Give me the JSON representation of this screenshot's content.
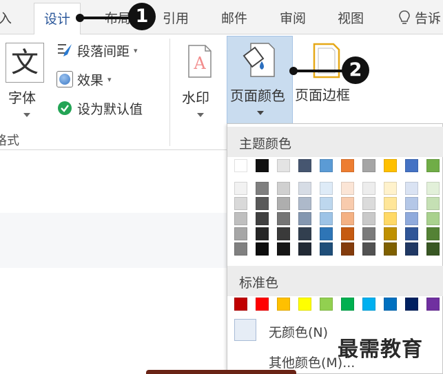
{
  "tabs": [
    {
      "name": "tab-insert",
      "label": "入"
    },
    {
      "name": "tab-design",
      "label": "设计",
      "active": true
    },
    {
      "name": "tab-layout",
      "label": "布局"
    },
    {
      "name": "tab-references",
      "label": "引用"
    },
    {
      "name": "tab-mailings",
      "label": "邮件"
    },
    {
      "name": "tab-review",
      "label": "审阅"
    },
    {
      "name": "tab-view",
      "label": "视图"
    },
    {
      "name": "tab-tell-me",
      "label": "告诉",
      "icon": "lightbulb-icon"
    }
  ],
  "ribbon": {
    "fonts_label": "字体",
    "paragraph_spacing_label": "段落间距",
    "effects_label": "效果",
    "set_default_label": "设为默认值",
    "group_label": "格式",
    "watermark_label": "水印",
    "page_color_label": "页面颜色",
    "page_borders_label": "页面边框"
  },
  "color_panel": {
    "theme_colors_title": "主题颜色",
    "theme_base": [
      "#ffffff",
      "#111111",
      "#e4e4e4",
      "#465670",
      "#5b9bd5",
      "#ed7d31",
      "#a5a5a5",
      "#ffc000",
      "#4472c4",
      "#70ad47"
    ],
    "theme_shades": [
      [
        "#f2f2f2",
        "#d9d9d9",
        "#bfbfbf",
        "#a6a6a6",
        "#808080"
      ],
      [
        "#7f7f7f",
        "#595959",
        "#404040",
        "#262626",
        "#0d0d0d"
      ],
      [
        "#d0d0d0",
        "#aeaeae",
        "#757575",
        "#3a3a3a",
        "#161616"
      ],
      [
        "#d6dce5",
        "#adb9ca",
        "#8497b0",
        "#323f4f",
        "#222a35"
      ],
      [
        "#deebf7",
        "#bdd7ee",
        "#9dc3e6",
        "#2e75b6",
        "#1f4e79"
      ],
      [
        "#fbe5d6",
        "#f8cbad",
        "#f4b183",
        "#c55a11",
        "#843c0c"
      ],
      [
        "#ededed",
        "#dbdbdb",
        "#c9c9c9",
        "#7b7b7b",
        "#525252"
      ],
      [
        "#fff2cc",
        "#ffe699",
        "#ffd966",
        "#bf9000",
        "#7f6000"
      ],
      [
        "#dae3f3",
        "#b4c7e7",
        "#8faadc",
        "#2f5597",
        "#203864"
      ],
      [
        "#e2f0d9",
        "#c5e0b4",
        "#a9d18e",
        "#548235",
        "#385723"
      ]
    ],
    "standard_colors_title": "标准色",
    "standard": [
      "#c00000",
      "#ff0000",
      "#ffc000",
      "#ffff00",
      "#92d050",
      "#00b050",
      "#00b0f0",
      "#0070c0",
      "#002060",
      "#7030a0"
    ],
    "no_color_label": "无颜色(N)",
    "more_colors_label": "其他颜色(M)..."
  },
  "callouts": [
    "1",
    "2"
  ],
  "watermark_text": "最需教育"
}
